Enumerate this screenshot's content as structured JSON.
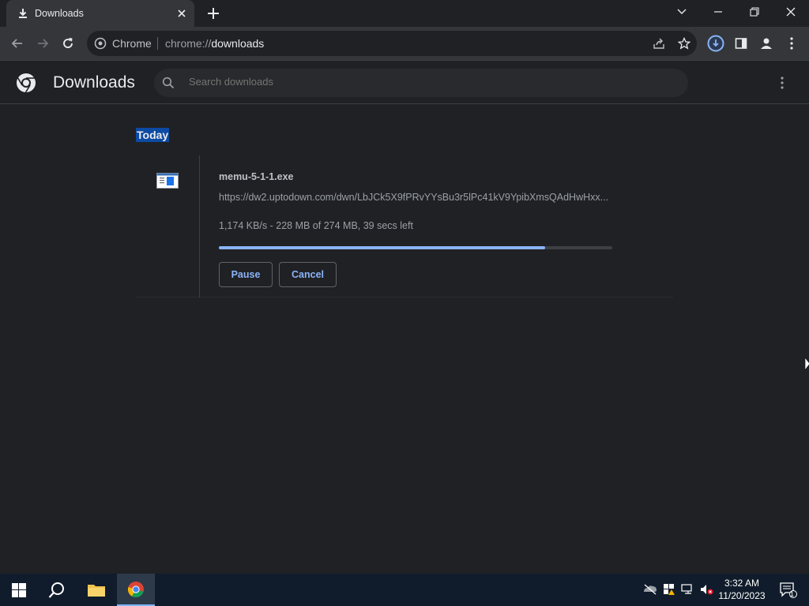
{
  "tab": {
    "title": "Downloads",
    "icon": "download-icon"
  },
  "toolbar": {
    "site_label": "Chrome",
    "url_scheme": "chrome://",
    "url_host": "downloads"
  },
  "downloads_page": {
    "title": "Downloads",
    "search_placeholder": "Search downloads"
  },
  "date_group": "Today",
  "download": {
    "filename": "memu-5-1-1.exe",
    "url": "https://dw2.uptodown.com/dwn/LbJCk5X9fPRvYYsBu3r5lPc41kV9YpibXmsQAdHwHxx...",
    "status": "1,174 KB/s - 228 MB of 274 MB, 39 secs left",
    "progress_fraction": 0.83,
    "pause_label": "Pause",
    "cancel_label": "Cancel"
  },
  "taskbar": {
    "time": "3:32 AM",
    "date": "11/20/2023",
    "notification_count": "1"
  },
  "colors": {
    "accent": "#8ab4f8",
    "highlight": "#0c4aa3"
  }
}
